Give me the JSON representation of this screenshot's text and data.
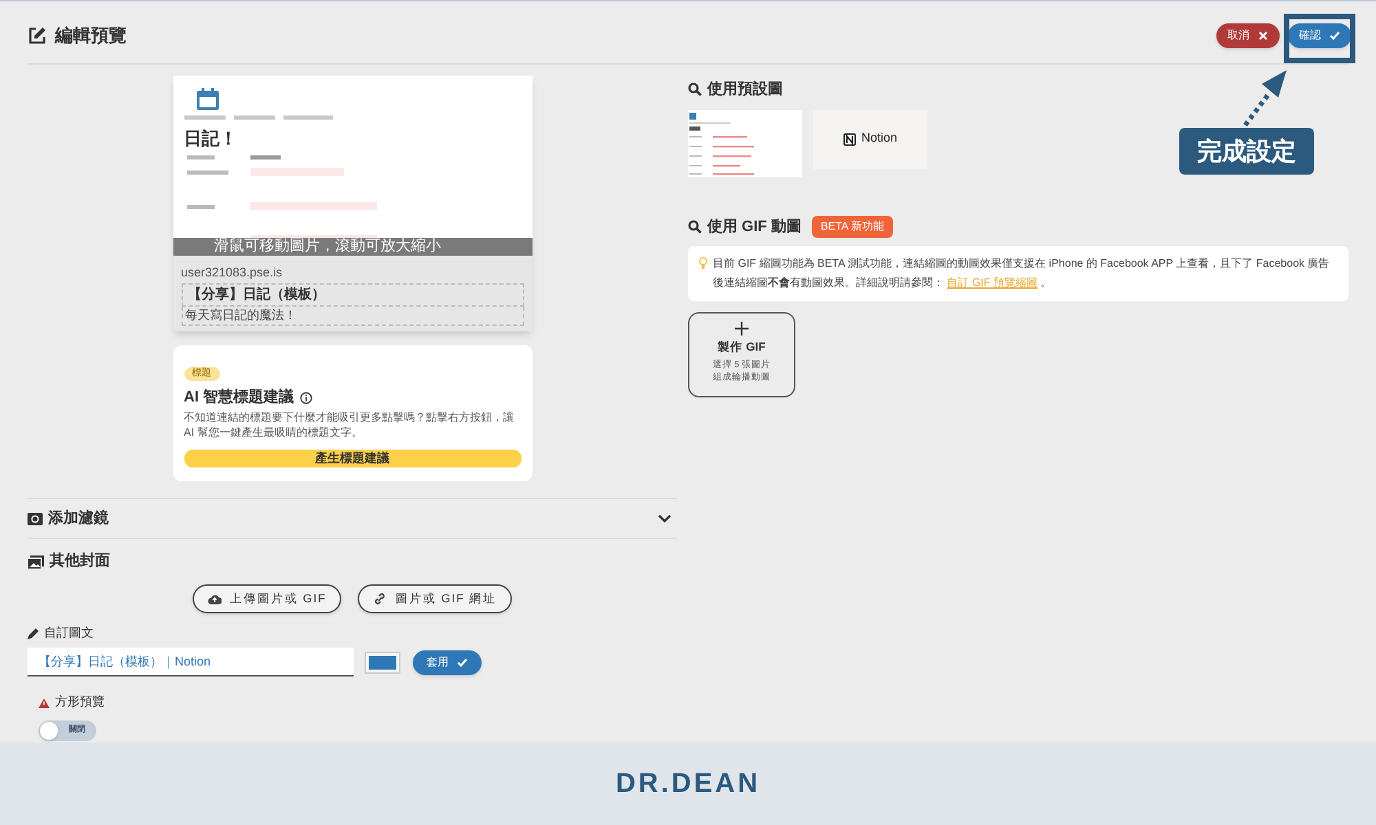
{
  "header": {
    "title": "編輯預覽",
    "buttons": [
      {
        "label": "取消",
        "kind": "cancel"
      },
      {
        "label": "確認",
        "kind": "confirm"
      }
    ]
  },
  "annotation": {
    "label": "完成設定"
  },
  "preview": {
    "page_title": "日記！",
    "overlay_hint": "滑鼠可移動圖片，滾動可放大縮小",
    "domain": "user321083.pse.is",
    "link_title": "【分享】日記（模板）",
    "link_description": "每天寫日記的魔法！"
  },
  "ai_card": {
    "badge": "標題",
    "title": "AI 智慧標題建議",
    "description": "不知道連結的標題要下什麼才能吸引更多點擊嗎？點擊右方按鈕，讓 AI 幫您一鍵產生最吸睛的標題文字。",
    "button": "產生標題建議"
  },
  "filter_section": {
    "label": "添加濾鏡",
    "expanded": false
  },
  "other_cover": {
    "label": "其他封面",
    "buttons": [
      {
        "label": "上傳圖片或 GIF",
        "kind": "upload"
      },
      {
        "label": "圖片或 GIF 網址",
        "kind": "link"
      }
    ]
  },
  "custom_text": {
    "label": "自訂圖文",
    "value": "【分享】日記（模板）｜Notion",
    "color": "#2f78b7",
    "apply_button": "套用"
  },
  "square_preview": {
    "label": "方形預覽",
    "toggle": {
      "on": false,
      "label": "關閉"
    }
  },
  "default_images": {
    "title": "使用預設圖",
    "options": [
      {
        "kind": "page"
      },
      {
        "kind": "notion",
        "label": "Notion"
      }
    ]
  },
  "gif": {
    "title": "使用 GIF 動圖",
    "badge": "BETA 新功能",
    "notice": "目前 GIF 縮圖功能為 BETA 測試功能，連結縮圖的動圖效果僅支援在 iPhone 的 Facebook APP 上查看，且下了 Facebook 廣告後連結縮圖**不會**有動圖效果。詳細說明請參閱：",
    "notice_link": "自訂 GIF 預覽縮圖",
    "notice_end": "。",
    "make_card": {
      "title": "製作 GIF",
      "lines": [
        "選擇 5 張圖片",
        "組成輪播動圖"
      ]
    }
  },
  "footer": {
    "logo": "DR.DEAN"
  }
}
